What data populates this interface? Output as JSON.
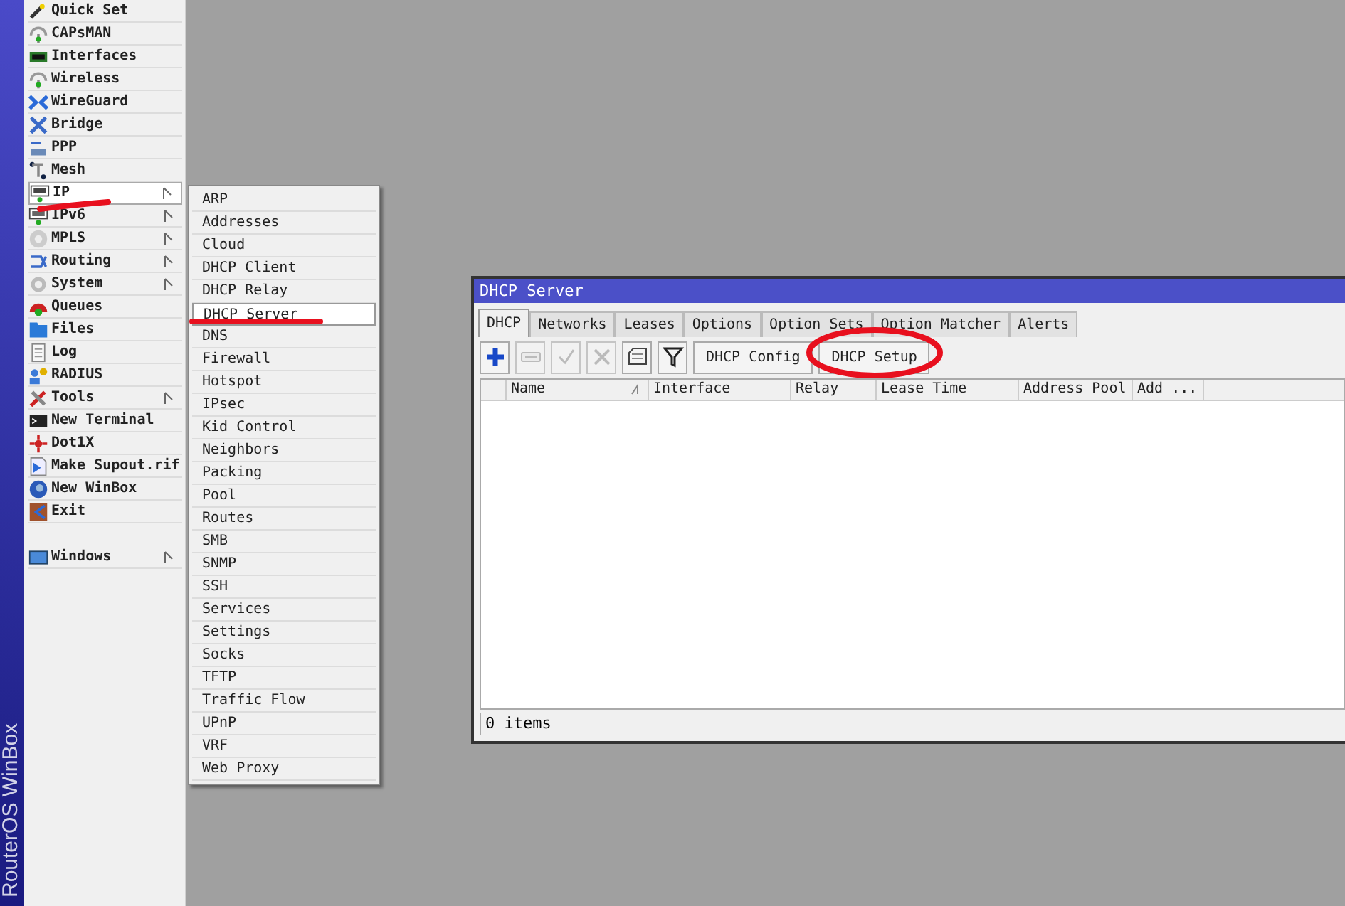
{
  "side_banner": "RouterOS WinBox",
  "menu": [
    {
      "label": "Quick Set",
      "has_submenu": false,
      "selected": false
    },
    {
      "label": "CAPsMAN",
      "has_submenu": false,
      "selected": false
    },
    {
      "label": "Interfaces",
      "has_submenu": false,
      "selected": false
    },
    {
      "label": "Wireless",
      "has_submenu": false,
      "selected": false
    },
    {
      "label": "WireGuard",
      "has_submenu": false,
      "selected": false
    },
    {
      "label": "Bridge",
      "has_submenu": false,
      "selected": false
    },
    {
      "label": "PPP",
      "has_submenu": false,
      "selected": false
    },
    {
      "label": "Mesh",
      "has_submenu": false,
      "selected": false
    },
    {
      "label": "IP",
      "has_submenu": true,
      "selected": true
    },
    {
      "label": "IPv6",
      "has_submenu": true,
      "selected": false
    },
    {
      "label": "MPLS",
      "has_submenu": true,
      "selected": false
    },
    {
      "label": "Routing",
      "has_submenu": true,
      "selected": false
    },
    {
      "label": "System",
      "has_submenu": true,
      "selected": false
    },
    {
      "label": "Queues",
      "has_submenu": false,
      "selected": false
    },
    {
      "label": "Files",
      "has_submenu": false,
      "selected": false
    },
    {
      "label": "Log",
      "has_submenu": false,
      "selected": false
    },
    {
      "label": "RADIUS",
      "has_submenu": false,
      "selected": false
    },
    {
      "label": "Tools",
      "has_submenu": true,
      "selected": false
    },
    {
      "label": "New Terminal",
      "has_submenu": false,
      "selected": false
    },
    {
      "label": "Dot1X",
      "has_submenu": false,
      "selected": false
    },
    {
      "label": "Make Supout.rif",
      "has_submenu": false,
      "selected": false
    },
    {
      "label": "New WinBox",
      "has_submenu": false,
      "selected": false
    },
    {
      "label": "Exit",
      "has_submenu": false,
      "selected": false
    },
    {
      "label": "Windows",
      "has_submenu": true,
      "selected": false,
      "gap_before": true
    }
  ],
  "submenu": [
    {
      "label": "ARP",
      "selected": false
    },
    {
      "label": "Addresses",
      "selected": false
    },
    {
      "label": "Cloud",
      "selected": false
    },
    {
      "label": "DHCP Client",
      "selected": false
    },
    {
      "label": "DHCP Relay",
      "selected": false
    },
    {
      "label": "DHCP Server",
      "selected": true
    },
    {
      "label": "DNS",
      "selected": false
    },
    {
      "label": "Firewall",
      "selected": false
    },
    {
      "label": "Hotspot",
      "selected": false
    },
    {
      "label": "IPsec",
      "selected": false
    },
    {
      "label": "Kid Control",
      "selected": false
    },
    {
      "label": "Neighbors",
      "selected": false
    },
    {
      "label": "Packing",
      "selected": false
    },
    {
      "label": "Pool",
      "selected": false
    },
    {
      "label": "Routes",
      "selected": false
    },
    {
      "label": "SMB",
      "selected": false
    },
    {
      "label": "SNMP",
      "selected": false
    },
    {
      "label": "SSH",
      "selected": false
    },
    {
      "label": "Services",
      "selected": false
    },
    {
      "label": "Settings",
      "selected": false
    },
    {
      "label": "Socks",
      "selected": false
    },
    {
      "label": "TFTP",
      "selected": false
    },
    {
      "label": "Traffic Flow",
      "selected": false
    },
    {
      "label": "UPnP",
      "selected": false
    },
    {
      "label": "VRF",
      "selected": false
    },
    {
      "label": "Web Proxy",
      "selected": false
    }
  ],
  "window": {
    "title": "DHCP Server",
    "tabs": [
      {
        "label": "DHCP",
        "selected": true
      },
      {
        "label": "Networks",
        "selected": false
      },
      {
        "label": "Leases",
        "selected": false
      },
      {
        "label": "Options",
        "selected": false
      },
      {
        "label": "Option Sets",
        "selected": false
      },
      {
        "label": "Option Matcher",
        "selected": false
      },
      {
        "label": "Alerts",
        "selected": false
      }
    ],
    "toolbar": [
      {
        "kind": "add",
        "disabled": false
      },
      {
        "kind": "remove",
        "disabled": true
      },
      {
        "kind": "enable",
        "disabled": true
      },
      {
        "kind": "disable",
        "disabled": true
      },
      {
        "kind": "comment",
        "disabled": false
      },
      {
        "kind": "filter",
        "disabled": false
      },
      {
        "kind": "text",
        "label": "DHCP Config"
      },
      {
        "kind": "text",
        "label": "DHCP Setup"
      }
    ],
    "table": {
      "columns": [
        "Name",
        "Interface",
        "Relay",
        "Lease Time",
        "Address Pool",
        "Add ..."
      ]
    },
    "status_bar": "0 items"
  }
}
